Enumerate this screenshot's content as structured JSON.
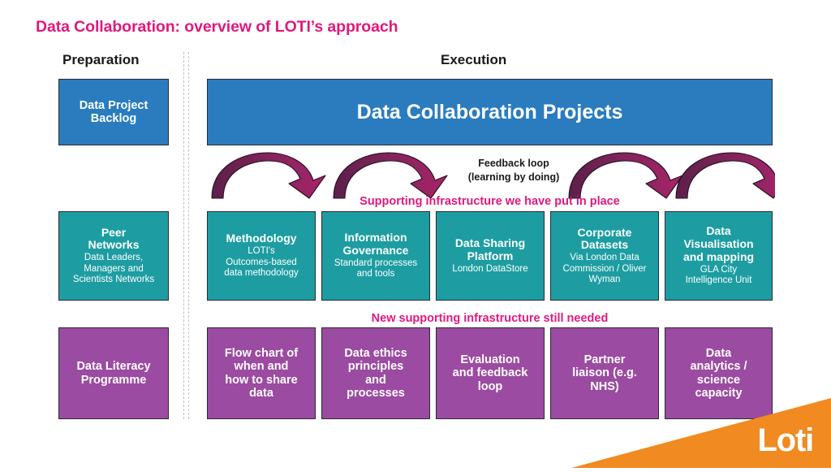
{
  "title": "Data Collaboration: overview of LOTI’s approach",
  "columns": {
    "preparation": "Preparation",
    "execution": "Execution"
  },
  "hero": {
    "label": "Data Collaboration Projects"
  },
  "preparation_column": {
    "backlog": {
      "title": "Data Project\nBacklog"
    },
    "peer_networks": {
      "title": "Peer\nNetworks",
      "subtitle": "Data Leaders,\nManagers and\nScientists Networks"
    },
    "data_literacy": {
      "title": "Data Literacy\nProgramme"
    }
  },
  "feedback": {
    "line1": "Feedback loop",
    "line2": "(learning by doing)",
    "arrow_count": 4
  },
  "captions": {
    "existing": "Supporting infrastructure we have put in place",
    "needed": "New supporting infrastructure still needed"
  },
  "existing_infrastructure": [
    {
      "title": "Methodology",
      "subtitle": "LOTI's\nOutcomes-based\ndata methodology"
    },
    {
      "title": "Information\nGovernance",
      "subtitle": "Standard processes\nand tools"
    },
    {
      "title": "Data Sharing\nPlatform",
      "subtitle": "London DataStore"
    },
    {
      "title": "Corporate\nDatasets",
      "subtitle": "Via London Data\nCommission / Oliver\nWyman"
    },
    {
      "title": "Data\nVisualisation\nand mapping",
      "subtitle": "GLA City\nIntelligence Unit"
    }
  ],
  "needed_infrastructure": [
    {
      "title": "Flow chart of\nwhen and\nhow to share\ndata"
    },
    {
      "title": "Data ethics\nprinciples\nand\nprocesses"
    },
    {
      "title": "Evaluation\nand feedback\nloop"
    },
    {
      "title": "Partner\nliaison (e.g.\nNHS)"
    },
    {
      "title": "Data\nanalytics /\nscience\ncapacity"
    }
  ],
  "branding": {
    "logo_text": "Loti"
  },
  "colors": {
    "accent_pink": "#e0197d",
    "blue": "#2a7cbf",
    "teal": "#1d9da1",
    "purple": "#9b4ba1",
    "orange": "#f18a21",
    "arrow_dark": "#5d1f4a",
    "arrow_light": "#a8246a",
    "border": "#2a2a33",
    "divider": "#b9c3c6",
    "text_dark": "#1a1a1a"
  }
}
